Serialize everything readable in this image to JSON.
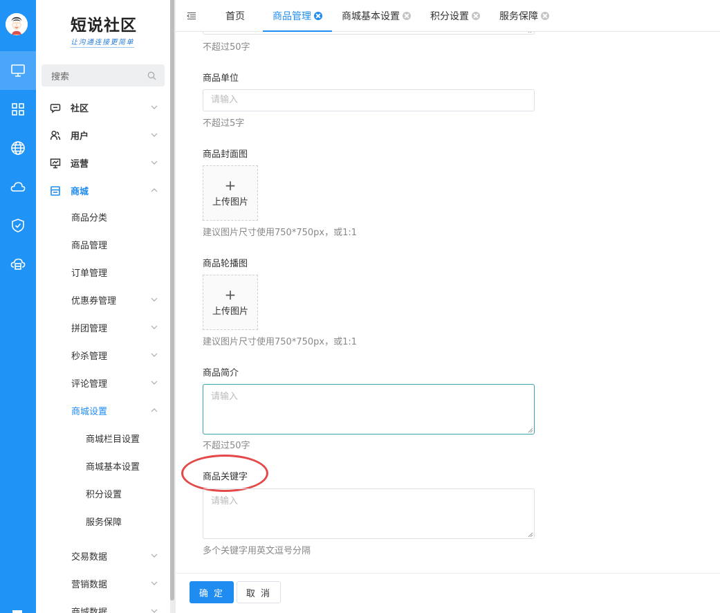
{
  "brand": {
    "title": "短说社区",
    "subtitle": "让沟通连接更简单"
  },
  "search": {
    "placeholder": "搜索"
  },
  "sidebar": {
    "groups": [
      {
        "label": "社区"
      },
      {
        "label": "用户"
      },
      {
        "label": "运营"
      },
      {
        "label": "商城"
      }
    ],
    "mall_items": [
      {
        "label": "商品分类"
      },
      {
        "label": "商品管理"
      },
      {
        "label": "订单管理"
      },
      {
        "label": "优惠券管理"
      },
      {
        "label": "拼团管理"
      },
      {
        "label": "秒杀管理"
      },
      {
        "label": "评论管理"
      },
      {
        "label": "商城设置"
      }
    ],
    "settings_items": [
      {
        "label": "商城栏目设置"
      },
      {
        "label": "商城基本设置"
      },
      {
        "label": "积分设置"
      },
      {
        "label": "服务保障"
      }
    ],
    "data_items": [
      {
        "label": "交易数据"
      },
      {
        "label": "营销数据"
      },
      {
        "label": "商城数据"
      }
    ]
  },
  "tabs": [
    {
      "label": "首页"
    },
    {
      "label": "商品管理"
    },
    {
      "label": "商城基本设置"
    },
    {
      "label": "积分设置"
    },
    {
      "label": "服务保障"
    }
  ],
  "form": {
    "name_hint": "不超过50字",
    "unit": {
      "label": "商品单位",
      "placeholder": "请输入",
      "hint": "不超过5字"
    },
    "cover": {
      "label": "商品封面图",
      "upload": "上传图片",
      "hint": "建议图片尺寸使用750*750px，或1:1"
    },
    "carousel": {
      "label": "商品轮播图",
      "upload": "上传图片",
      "hint": "建议图片尺寸使用750*750px，或1:1"
    },
    "intro": {
      "label": "商品简介",
      "placeholder": "请输入",
      "hint": "不超过50字"
    },
    "keywords": {
      "label": "商品关键字",
      "placeholder": "请输入",
      "hint": "多个关键字用英文逗号分隔"
    }
  },
  "actions": {
    "confirm": "确 定",
    "cancel": "取 消"
  },
  "colors": {
    "primary": "#1f8cf2",
    "rail": "#2093f7",
    "highlight_circle": "#e54848"
  }
}
